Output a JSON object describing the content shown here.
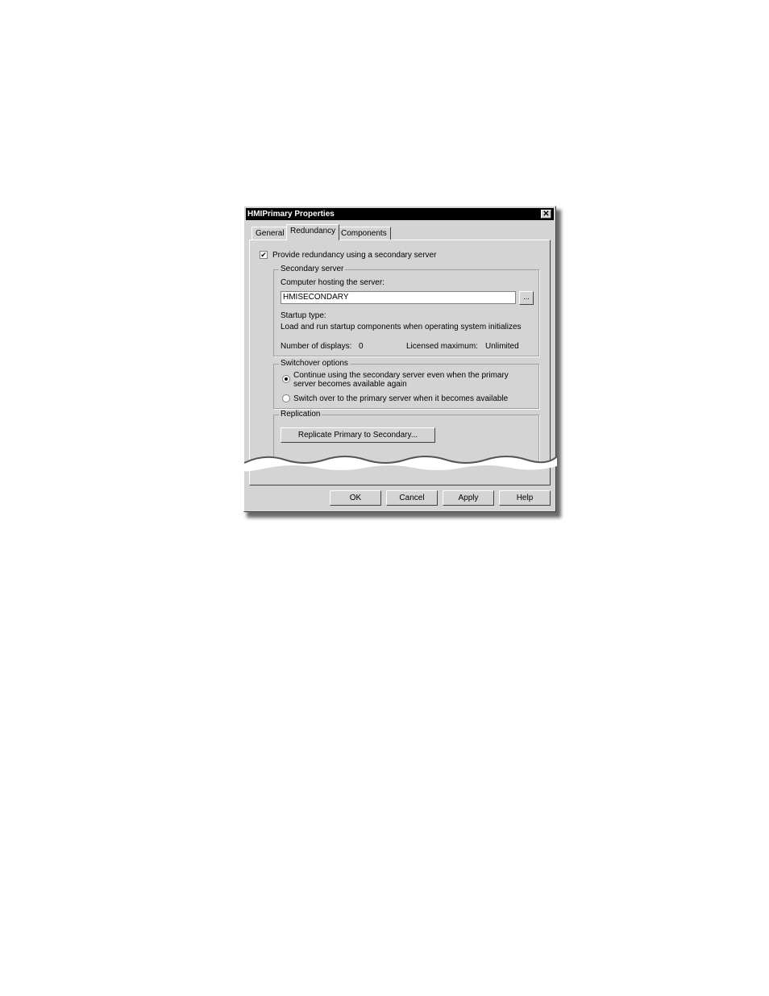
{
  "window": {
    "title": "HMIPrimary Properties",
    "close_glyph": "✕"
  },
  "tabs": [
    {
      "label": "General",
      "active": false
    },
    {
      "label": "Redundancy",
      "active": true
    },
    {
      "label": "Components",
      "active": false
    }
  ],
  "redundancy": {
    "checkbox_label": "Provide redundancy using a secondary server",
    "checked": true,
    "check_glyph": "✔"
  },
  "secondary_server": {
    "group_title": "Secondary server",
    "host_label": "Computer hosting the server:",
    "host_value": "HMISECONDARY",
    "browse_label": "...",
    "startup_type_label": "Startup type:",
    "startup_type_value": "Load and run startup components when operating system initializes",
    "displays_label": "Number of displays:",
    "displays_value": "0",
    "licensed_label": "Licensed maximum:",
    "licensed_value": "Unlimited"
  },
  "switchover": {
    "group_title": "Switchover options",
    "options": [
      {
        "label": "Continue using the secondary server even when the primary server becomes available again",
        "selected": true
      },
      {
        "label": "Switch over to the primary server when it becomes available",
        "selected": false
      }
    ]
  },
  "replication": {
    "group_title": "Replication",
    "button_label": "Replicate Primary to Secondary..."
  },
  "footer": {
    "ok": "OK",
    "cancel": "Cancel",
    "apply": "Apply",
    "help": "Help"
  }
}
